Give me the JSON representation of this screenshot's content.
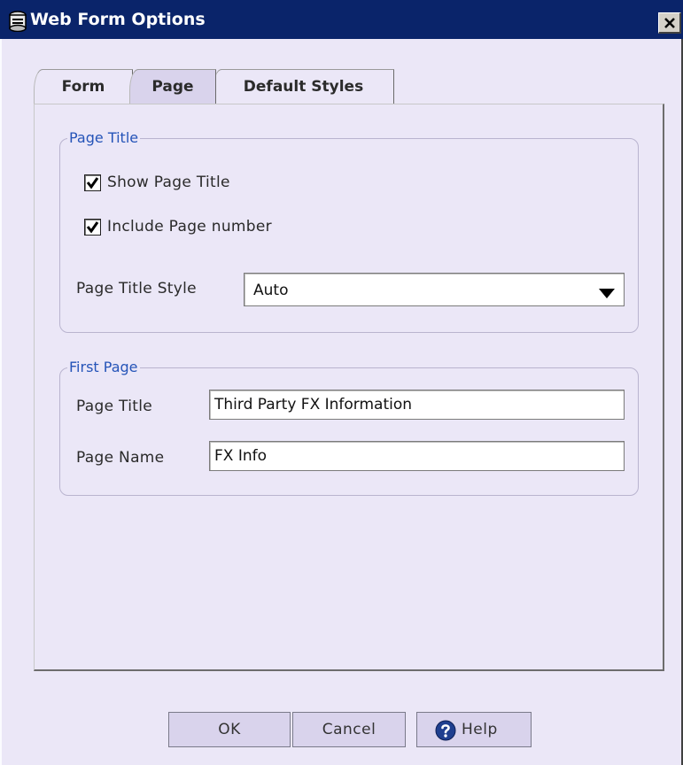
{
  "window": {
    "title": "Web Form Options",
    "close_glyph": "×"
  },
  "tabs": [
    {
      "label": "Form",
      "selected": false
    },
    {
      "label": "Page",
      "selected": true
    },
    {
      "label": "Default Styles",
      "selected": false
    }
  ],
  "page_title_group": {
    "legend": "Page Title",
    "show_page_title": {
      "label": "Show Page Title",
      "checked": true
    },
    "include_page_number": {
      "label": "Include Page number",
      "checked": true
    },
    "style_label": "Page Title Style",
    "style_value": "Auto"
  },
  "first_page_group": {
    "legend": "First Page",
    "page_title_label": "Page Title",
    "page_title_value": "Third Party FX Information",
    "page_name_label": "Page Name",
    "page_name_value": "FX Info"
  },
  "buttons": {
    "ok": "OK",
    "cancel": "Cancel",
    "help": "Help"
  },
  "icons": {
    "app": "form-app-icon",
    "close": "close-icon",
    "check": "checkmark-icon",
    "dropdown": "dropdown-arrow-icon",
    "help": "help-question-icon"
  },
  "colors": {
    "titlebar": "#0A246A",
    "background": "#EBE7F7",
    "legend_text": "#2554B8",
    "button_face": "#D9D3EC"
  }
}
